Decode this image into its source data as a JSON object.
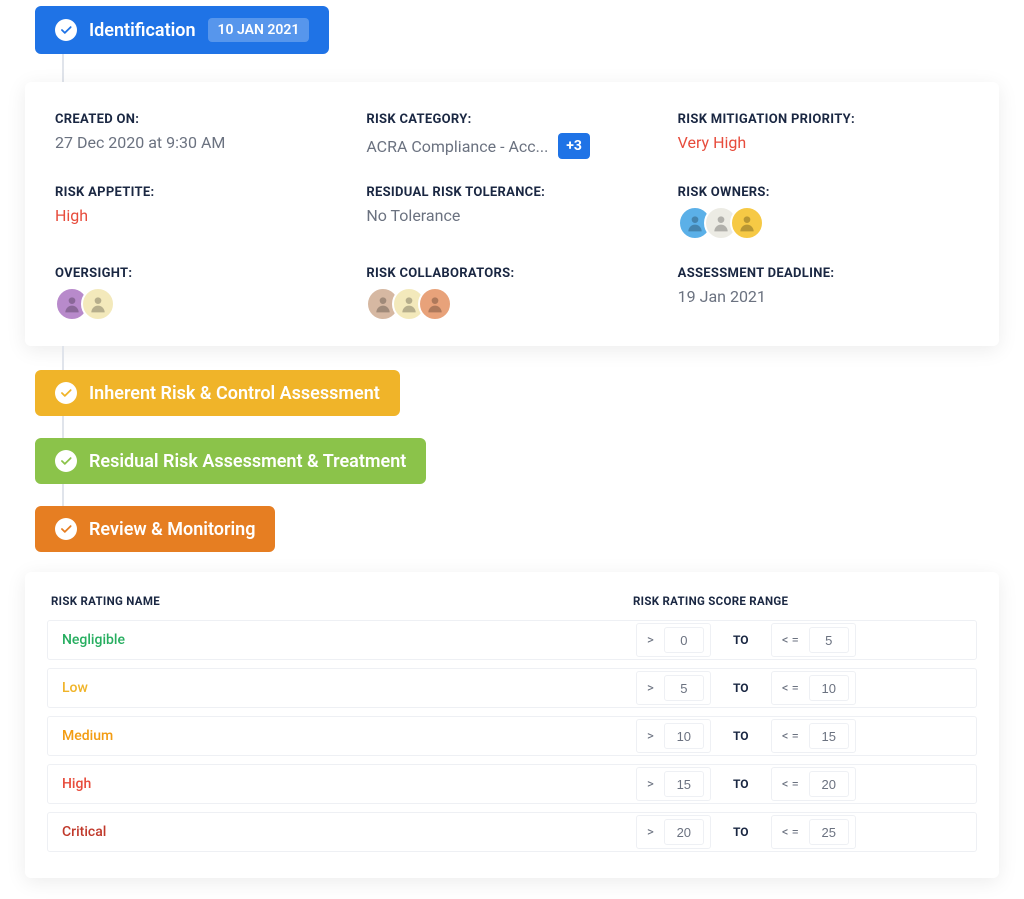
{
  "stages": {
    "identification": {
      "label": "Identification",
      "date": "10 JAN 2021"
    },
    "inherent": {
      "label": "Inherent Risk & Control Assessment"
    },
    "residual": {
      "label": "Residual Risk Assessment & Treatment"
    },
    "review": {
      "label": "Review & Monitoring"
    }
  },
  "details": {
    "created_on": {
      "label": "CREATED ON:",
      "value": "27 Dec 2020 at 9:30 AM"
    },
    "risk_category": {
      "label": "RISK CATEGORY:",
      "value": "ACRA Compliance - Acc...",
      "more": "+3"
    },
    "mitigation_priority": {
      "label": "RISK MITIGATION PRIORITY:",
      "value": "Very High"
    },
    "risk_appetite": {
      "label": "RISK APPETITE:",
      "value": "High"
    },
    "residual_tolerance": {
      "label": "RESIDUAL RISK TOLERANCE:",
      "value": "No Tolerance"
    },
    "risk_owners": {
      "label": "RISK OWNERS:"
    },
    "oversight": {
      "label": "OVERSIGHT:"
    },
    "risk_collaborators": {
      "label": "RISK COLLABORATORS:"
    },
    "assessment_deadline": {
      "label": "ASSESSMENT DEADLINE:",
      "value": "19 Jan 2021"
    }
  },
  "avatars": {
    "owners": [
      {
        "bg": "#5bb0e8"
      },
      {
        "bg": "#ecebe4"
      },
      {
        "bg": "#f6c945"
      }
    ],
    "oversight": [
      {
        "bg": "#b88acb"
      },
      {
        "bg": "#f3e9bb"
      }
    ],
    "collaborators": [
      {
        "bg": "#d6b8a2"
      },
      {
        "bg": "#f3e9bb"
      },
      {
        "bg": "#e8a27a"
      }
    ]
  },
  "table": {
    "header_name": "RISK RATING NAME",
    "header_range": "RISK RATING SCORE RANGE",
    "to_label": "TO",
    "gt": ">",
    "lte": "< =",
    "rows": [
      {
        "name": "Negligible",
        "class": "negligible",
        "min": "0",
        "max": "5"
      },
      {
        "name": "Low",
        "class": "low",
        "min": "5",
        "max": "10"
      },
      {
        "name": "Medium",
        "class": "medium",
        "min": "10",
        "max": "15"
      },
      {
        "name": "High",
        "class": "high",
        "min": "15",
        "max": "20"
      },
      {
        "name": "Critical",
        "class": "critical",
        "min": "20",
        "max": "25"
      }
    ]
  }
}
